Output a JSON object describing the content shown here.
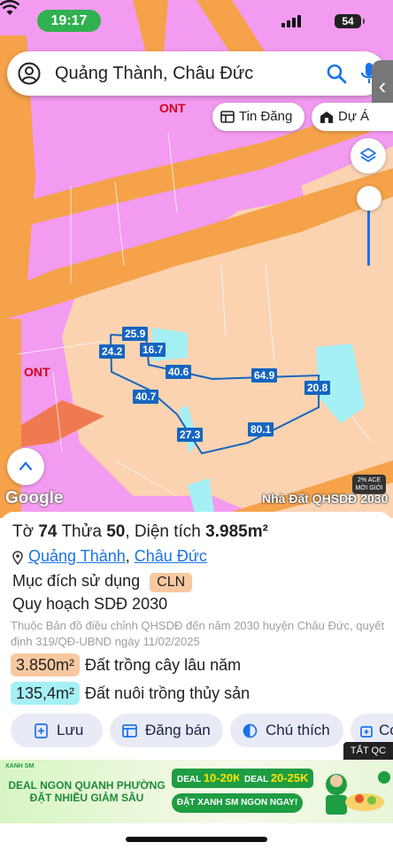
{
  "status_bar": {
    "time": "19:17",
    "battery": "54"
  },
  "search": {
    "query": "Quảng Thành, Châu Đức"
  },
  "chips": {
    "listing": "Tin Đăng",
    "project": "Dự Á"
  },
  "map": {
    "zone_labels": [
      "ONT",
      "ONT"
    ],
    "edge_labels": [
      "25.9",
      "24.2",
      "16.7",
      "40.6",
      "64.9",
      "20.8",
      "40.7",
      "27.3",
      "80.1"
    ],
    "logo": "Google",
    "attribution": "Nhà Đất QHSDĐ 2030",
    "promo_badge": "2% ACE MỜI GIỚI"
  },
  "parcel": {
    "title_prefix": "Tờ",
    "sheet_no": "74",
    "plot_prefix": "Thửa",
    "plot_no": "50",
    "area_prefix": "Diện tích",
    "area": "3.985m²",
    "location_commune": "Quảng Thành",
    "location_district": "Châu Đức",
    "purpose_label": "Mục đích sử dụng",
    "purpose_code": "CLN",
    "plan_label": "Quy hoạch SDĐ 2030",
    "plan_description": "Thuộc Bản đồ điều chỉnh QHSDĐ đến năm 2030 huyện Châu Đức, quyết định 319/QĐ-UBND ngày 11/02/2025",
    "areas": [
      {
        "value": "3.850m²",
        "label": "Đất trồng cây lâu năm",
        "color": "#f8c9a0"
      },
      {
        "value": "135,4m²",
        "label": "Đất nuôi trồng thủy sản",
        "color": "#a5f0f5"
      }
    ]
  },
  "actions": {
    "save": "Lưu",
    "post": "Đăng bán",
    "legend": "Chú thích",
    "copy": "Co"
  },
  "ad": {
    "close": "TẮT QC",
    "brand": "XANH SM",
    "headline": "DEAL NGON QUANH PHƯỜNG ĐẶT NHIỀU GIẢM SÂU",
    "deal1_prefix": "DEAL",
    "deal1_value": "10-20K",
    "deal2_prefix": "DEAL",
    "deal2_value": "20-25K",
    "cta": "ĐẶT XANH SM NGON NGAY!"
  },
  "colors": {
    "pink": "#f39bf0",
    "orange": "#f5a24a",
    "peach": "#fbd3b1",
    "cyan": "#a5f0f5",
    "blue": "#1a73e8"
  }
}
